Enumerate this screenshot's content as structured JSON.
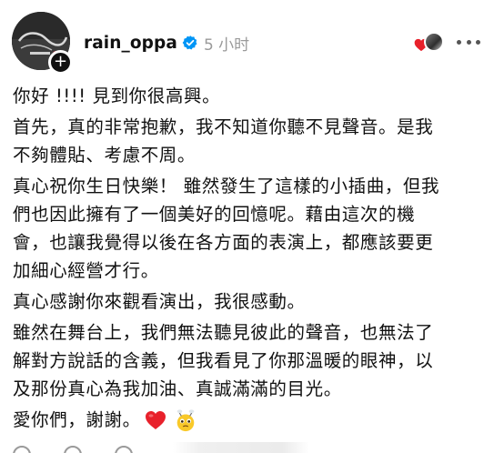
{
  "post": {
    "username": "rain_oppa",
    "timestamp": "5 小时",
    "avatar_icon": "profile-avatar",
    "verified_icon": "verified-badge-icon",
    "reactor_icon": "liked-by-avatar",
    "more_icon": "more-horizontal-icon",
    "add_icon": "+"
  },
  "body": {
    "paragraphs": [
      "你好 !!!! 見到你很高興。",
      "首先，真的非常抱歉，我不知道你聽不見聲音。是我\n不夠體貼、考慮不周。",
      "真心祝你生日快樂！ 雖然發生了這樣的小插曲，但我\n們也因此擁有了一個美好的回憶呢。藉由這次的機\n會，也讓我覺得以後在各方面的表演上，都應該要更\n加細心經營才行。",
      "真心感謝你來觀看演出，我很感動。",
      "雖然在舞台上，我們無法聽見彼此的聲音，也無法了\n解對方說話的含義，但我看見了你那溫暖的眼神，以\n及那份真心為我加油、真誠滿滿的目光。",
      "愛你們，謝謝。"
    ],
    "emoji": [
      "red-heart-icon",
      "pleading-face-icon"
    ]
  },
  "colors": {
    "text": "#111111",
    "muted": "#9a9a9a",
    "verified": "#0095f6",
    "heart": "#e8212b"
  }
}
